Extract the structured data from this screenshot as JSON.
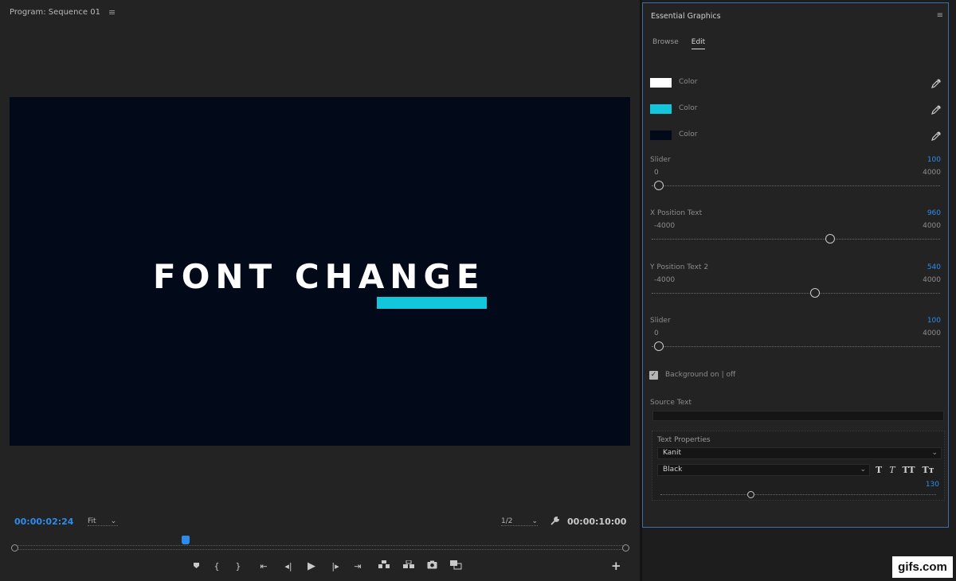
{
  "program": {
    "title": "Program: Sequence 01",
    "menu_icon": "hamburger-menu-icon",
    "viewer": {
      "headline": "FONT CHANGE",
      "background_color": "#020a1a",
      "bar_color": "#12c6dc"
    },
    "current_timecode": "00:00:02:24",
    "zoom_label": "Fit",
    "resolution_label": "1/2",
    "total_timecode": "00:00:10:00",
    "playhead_fraction": 0.28
  },
  "transport": {
    "icons": [
      "marker-icon",
      "mark-in-icon",
      "mark-out-icon",
      "go-to-in-icon",
      "step-back-icon",
      "play-icon",
      "step-forward-icon",
      "go-to-out-icon",
      "lift-icon",
      "extract-icon",
      "export-frame-icon",
      "compare-icon"
    ],
    "add_icon": "plus-icon"
  },
  "essential_graphics": {
    "title": "Essential Graphics",
    "tabs": [
      {
        "label": "Browse",
        "active": false
      },
      {
        "label": "Edit",
        "active": true
      }
    ],
    "colors": [
      {
        "label": "Color",
        "swatch": "#ffffff"
      },
      {
        "label": "Color",
        "swatch": "#12c6dc"
      },
      {
        "label": "Color",
        "swatch": "#020a1a"
      }
    ],
    "sliders": [
      {
        "name": "Slider",
        "value": "100",
        "min": "0",
        "max": "4000",
        "fraction": 0.025
      },
      {
        "name": "X Position Text",
        "value": "960",
        "min": "-4000",
        "max": "4000",
        "fraction": 0.62
      },
      {
        "name": "Y Position Text 2",
        "value": "540",
        "min": "-4000",
        "max": "4000",
        "fraction": 0.5675
      },
      {
        "name": "Slider",
        "value": "100",
        "min": "0",
        "max": "4000",
        "fraction": 0.025
      }
    ],
    "checkbox": {
      "label": "Background on | off",
      "checked": true
    },
    "source_text_label": "Source Text",
    "source_text_value": "",
    "text_properties": {
      "label": "Text Properties",
      "font": "Kanit",
      "style": "Black",
      "style_buttons": [
        "T",
        "T",
        "TT",
        "Tт"
      ],
      "size": "130",
      "size_fraction": 0.33
    }
  },
  "watermark": "gifs.com"
}
